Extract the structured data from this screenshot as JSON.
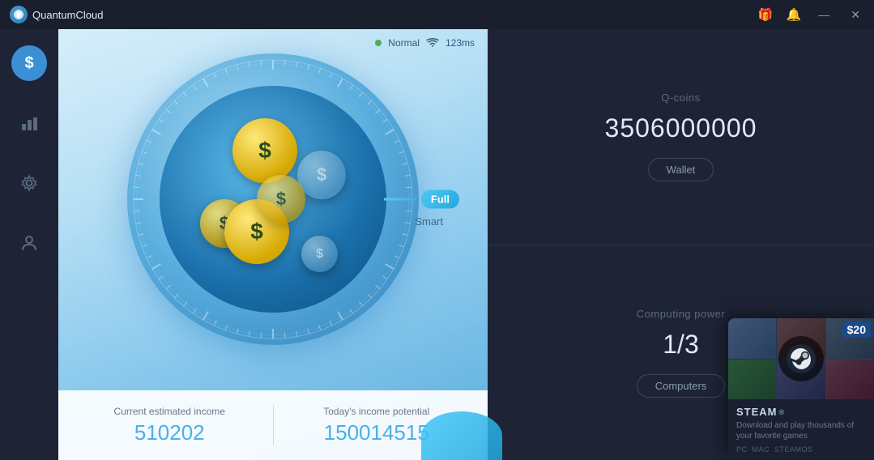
{
  "app": {
    "name": "QuantumCloud",
    "titlebar": {
      "gift_icon": "🎁",
      "bell_icon": "🔔",
      "minimize_label": "—",
      "close_label": "✕"
    }
  },
  "sidebar": {
    "items": [
      {
        "id": "wallet",
        "icon": "$",
        "active": true
      },
      {
        "id": "stats",
        "icon": "▦",
        "active": false
      },
      {
        "id": "settings",
        "icon": "⚙",
        "active": false
      },
      {
        "id": "profile",
        "icon": "👤",
        "active": false
      }
    ]
  },
  "status": {
    "mode": "Normal",
    "ping": "123ms"
  },
  "gauge": {
    "mode_label": "Full",
    "smart_label": "Smart"
  },
  "stats": {
    "current_label": "Current estimated income",
    "current_value": "510202",
    "potential_label": "Today's income potential",
    "potential_value": "150014515"
  },
  "qcoins": {
    "label": "Q-coins",
    "value": "3506000000",
    "wallet_button": "Wallet"
  },
  "computing": {
    "label": "Computing power",
    "value": "1/3",
    "computers_button": "Computers"
  },
  "steam_card": {
    "price": "$20",
    "title": "STEAM",
    "reg_symbol": "®",
    "description": "Download and play thousands of your favorite games",
    "platforms": [
      "PC",
      "MAC",
      "STEAMOS"
    ]
  }
}
